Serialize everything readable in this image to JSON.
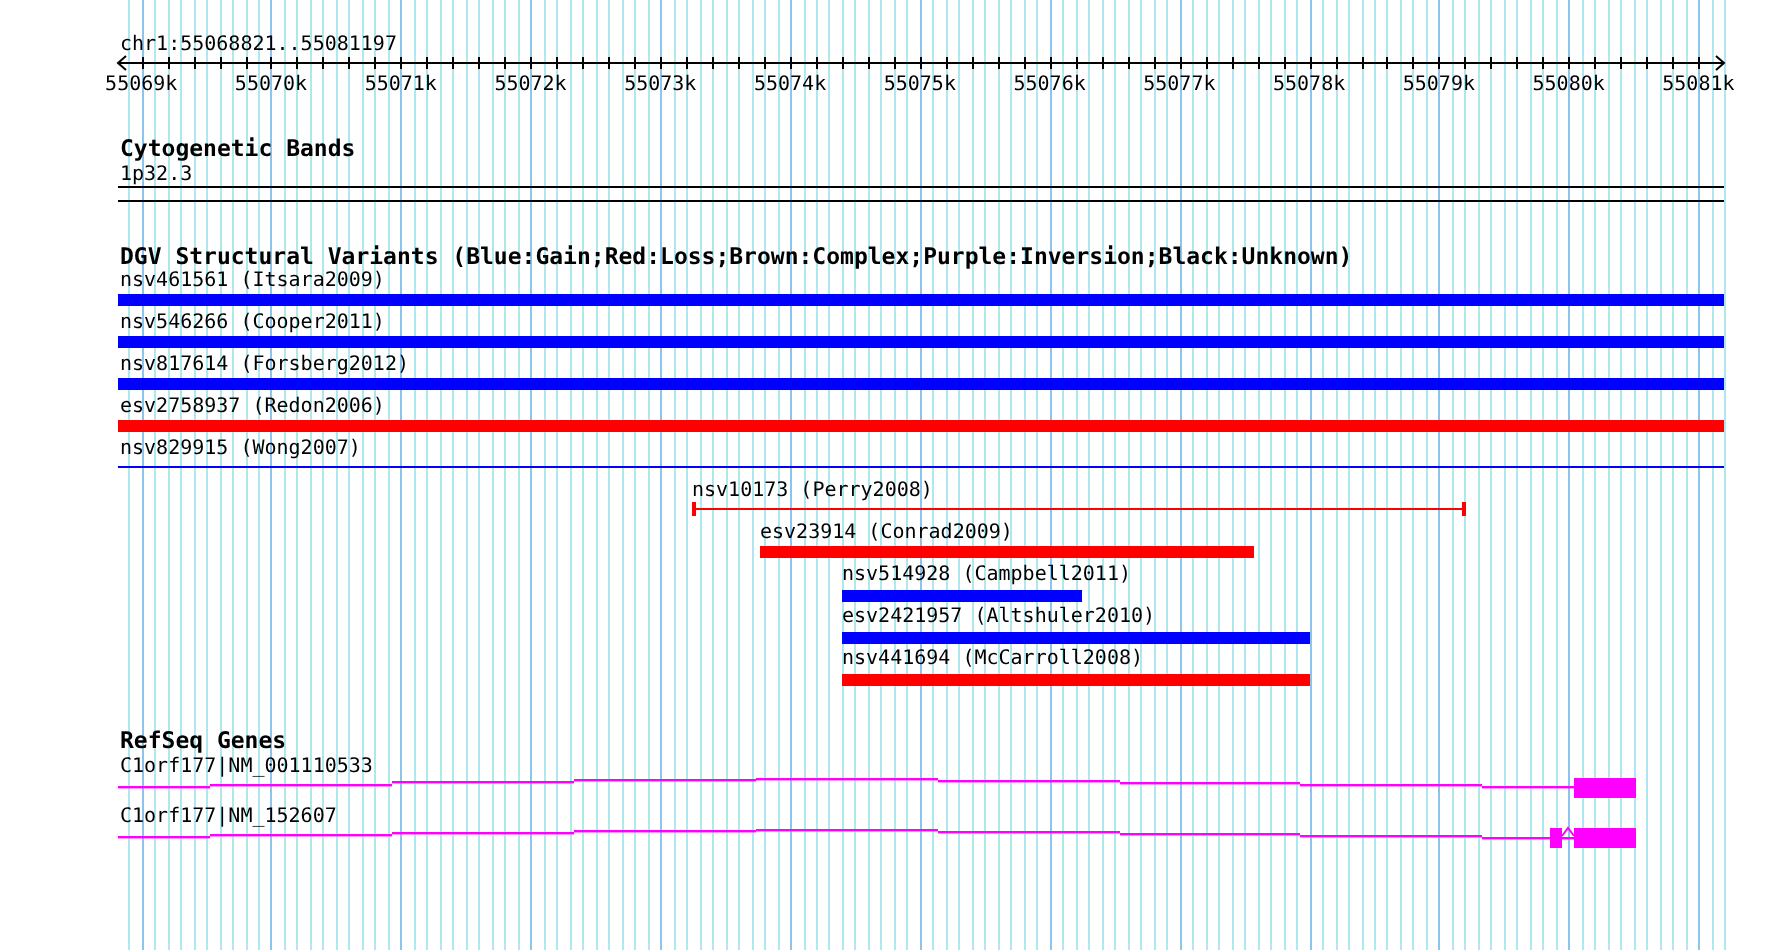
{
  "position": "chr1:55068821..55081197",
  "ruler": {
    "ticks": [
      "55069k",
      "55070k",
      "55071k",
      "55072k",
      "55073k",
      "55074k",
      "55075k",
      "55076k",
      "55077k",
      "55078k",
      "55079k",
      "55080k",
      "55081k"
    ]
  },
  "cytoband": {
    "title": "Cytogenetic Bands",
    "band": "1p32.3"
  },
  "dgv": {
    "title": "DGV Structural Variants (Blue:Gain;Red:Loss;Brown:Complex;Purple:Inversion;Black:Unknown)",
    "variants": [
      {
        "label": "nsv461561 (Itsara2009)",
        "color": "#0000ff",
        "kind": "bar"
      },
      {
        "label": "nsv546266 (Cooper2011)",
        "color": "#0000ff",
        "kind": "bar"
      },
      {
        "label": "nsv817614 (Forsberg2012)",
        "color": "#0000ff",
        "kind": "bar"
      },
      {
        "label": "esv2758937 (Redon2006)",
        "color": "#ff0000",
        "kind": "bar"
      },
      {
        "label": "nsv829915 (Wong2007)",
        "color": "#0000ff",
        "kind": "line"
      },
      {
        "label": "nsv10173 (Perry2008)",
        "color": "#ff0000",
        "kind": "range"
      },
      {
        "label": "esv23914 (Conrad2009)",
        "color": "#ff0000",
        "kind": "bar"
      },
      {
        "label": "nsv514928 (Campbell2011)",
        "color": "#0000ff",
        "kind": "bar"
      },
      {
        "label": "esv2421957 (Altshuler2010)",
        "color": "#0000ff",
        "kind": "bar"
      },
      {
        "label": "nsv441694 (McCarroll2008)",
        "color": "#ff0000",
        "kind": "bar"
      }
    ]
  },
  "refseq": {
    "title": "RefSeq Genes",
    "genes": [
      {
        "label": "C1orf177|NM_001110533"
      },
      {
        "label": "C1orf177|NM_152607"
      }
    ]
  }
}
